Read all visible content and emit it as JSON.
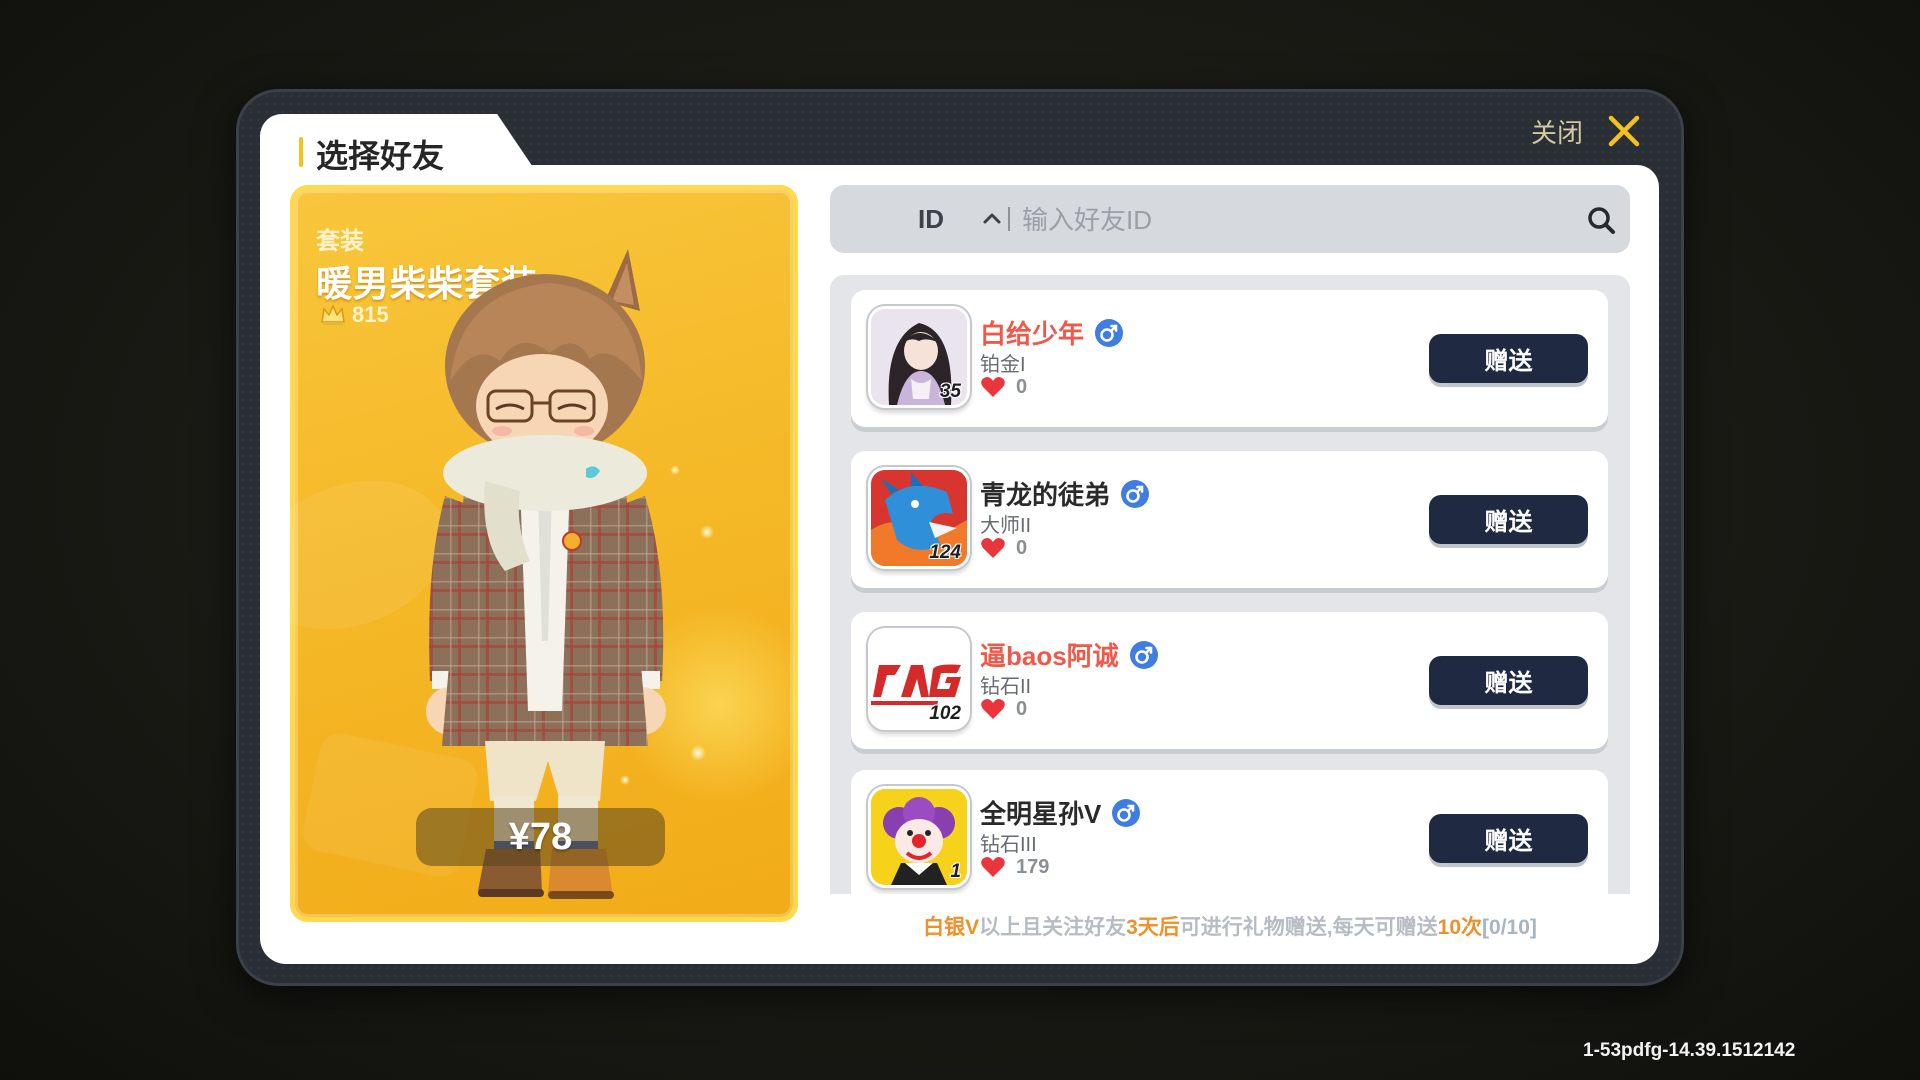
{
  "dialog": {
    "title": "选择好友",
    "close_label": "关闭",
    "close_icon": "close-x-icon"
  },
  "item": {
    "category": "套装",
    "name": "暖男柴柴套装",
    "popularity_icon": "crown-icon",
    "popularity": "815",
    "price": "¥78"
  },
  "search": {
    "filter_label": "ID",
    "filter_icon": "chevron-up-icon",
    "placeholder": "输入好友ID",
    "value": "",
    "icon": "search-icon"
  },
  "friends": [
    {
      "name": "白给少年",
      "name_color": "#f0584a",
      "gender_icon": "male-icon",
      "rank": "铂金I",
      "likes_icon": "heart-icon",
      "likes": "0",
      "level": "35",
      "action_label": "赠送"
    },
    {
      "name": "青龙的徒弟",
      "name_color": "#2a2a2a",
      "gender_icon": "male-icon",
      "rank": "大师II",
      "likes_icon": "heart-icon",
      "likes": "0",
      "level": "124",
      "action_label": "赠送"
    },
    {
      "name": "逼baos阿诚",
      "name_color": "#f0584a",
      "gender_icon": "male-icon",
      "rank": "钻石II",
      "likes_icon": "heart-icon",
      "likes": "0",
      "level": "102",
      "action_label": "赠送"
    },
    {
      "name": "全明星孙V",
      "name_color": "#2a2a2a",
      "gender_icon": "male-icon",
      "rank": "钻石III",
      "likes_icon": "heart-icon",
      "likes": "179",
      "level": "1",
      "action_label": "赠送"
    }
  ],
  "footer": {
    "p1": "白银V",
    "p2": "以上且关注好友",
    "p3": "3天后",
    "p4": "可进行礼物赠送,每天可赠送",
    "p5": "10次",
    "p6": "[0/10]"
  },
  "build_version": "1-53pdfg-14.39.1512142",
  "colors": {
    "accent": "#f5c21b",
    "button": "#1f2a42",
    "highlight": "#f0902a",
    "gender": "#3f7de0",
    "heart": "#e8363c"
  }
}
